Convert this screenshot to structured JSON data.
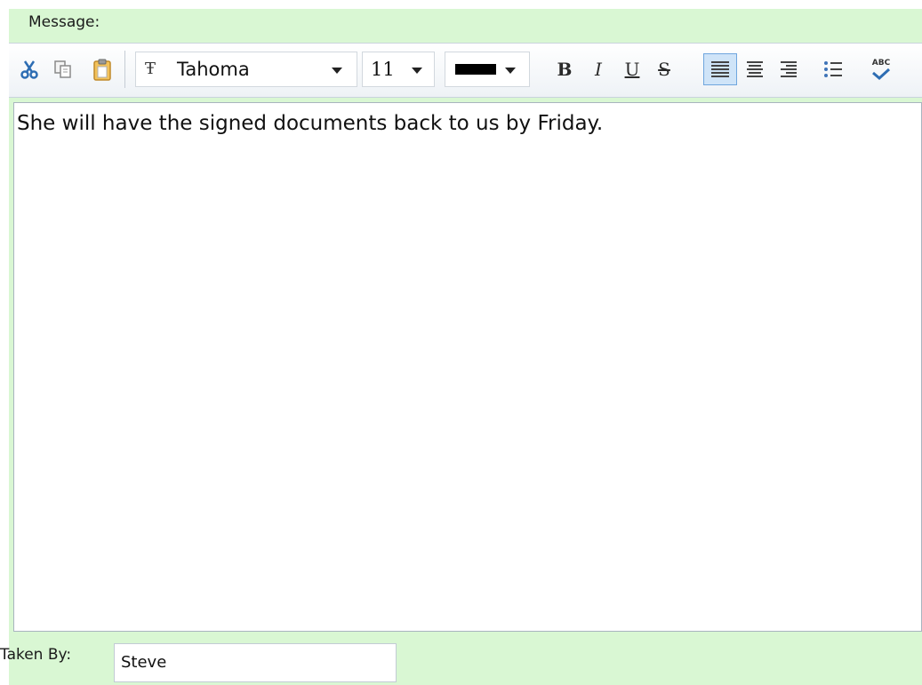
{
  "message": {
    "label": "Message:"
  },
  "toolbar": {
    "font": {
      "name": "Tahoma",
      "icon": "font-icon",
      "icon_glyph": "Ŧ"
    },
    "size": "11",
    "text_color": "#000000",
    "bold_label": "B",
    "italic_label": "I",
    "underline_label": "U",
    "strike_label": "S",
    "spellcheck_label": "ABC",
    "active_alignment": "left"
  },
  "editor": {
    "text": "She will have the signed documents back to us by Friday."
  },
  "taken_by": {
    "label": "Taken By:",
    "value": "Steve"
  },
  "colors": {
    "panel_bg": "#d9f7d3",
    "active_button": "#cfe4f8"
  }
}
